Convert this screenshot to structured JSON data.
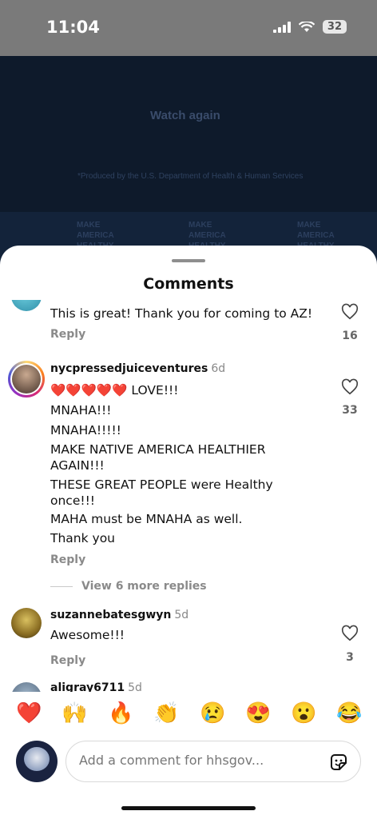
{
  "status_bar": {
    "time": "11:04",
    "battery": "32"
  },
  "backdrop": {
    "watch_again": "Watch again",
    "produced_by": "*Produced by the U.S. Department of Health & Human Services",
    "tiles": [
      "MAKE AMERICA HEALTHY AGAIN"
    ]
  },
  "sheet": {
    "title": "Comments"
  },
  "comments": [
    {
      "username": "",
      "time": "",
      "lines": [
        "This is great! Thank you for coming to AZ!"
      ],
      "reply_label": "Reply",
      "likes": "16"
    },
    {
      "username": "nycpressedjuiceventures",
      "time": "6d",
      "lines": [
        "❤️❤️❤️❤️❤️ LOVE!!!",
        "MNAHA!!!",
        "MNAHA!!!!!",
        "MAKE NATIVE AMERICA HEALTHIER",
        "AGAIN!!!",
        "THESE GREAT PEOPLE were Healthy",
        "once!!!",
        "MAHA must be MNAHA as well.",
        "Thank you"
      ],
      "reply_label": "Reply",
      "likes": "33",
      "view_replies": "View 6 more replies"
    },
    {
      "username": "suzannebatesgwyn",
      "time": "5d",
      "lines": [
        "Awesome!!!"
      ],
      "reply_label": "Reply",
      "likes": "3"
    },
    {
      "username": "aligray6711",
      "time": "5d"
    }
  ],
  "emoji_bar": [
    "❤️",
    "🙌",
    "🔥",
    "👏",
    "😢",
    "😍",
    "😮",
    "😂"
  ],
  "composer": {
    "placeholder": "Add a comment for hhsgov..."
  },
  "colors": {
    "heart_red": "#e3263a",
    "backdrop_navy": "#0e1a2b",
    "status_gray": "#7a7a7a"
  }
}
